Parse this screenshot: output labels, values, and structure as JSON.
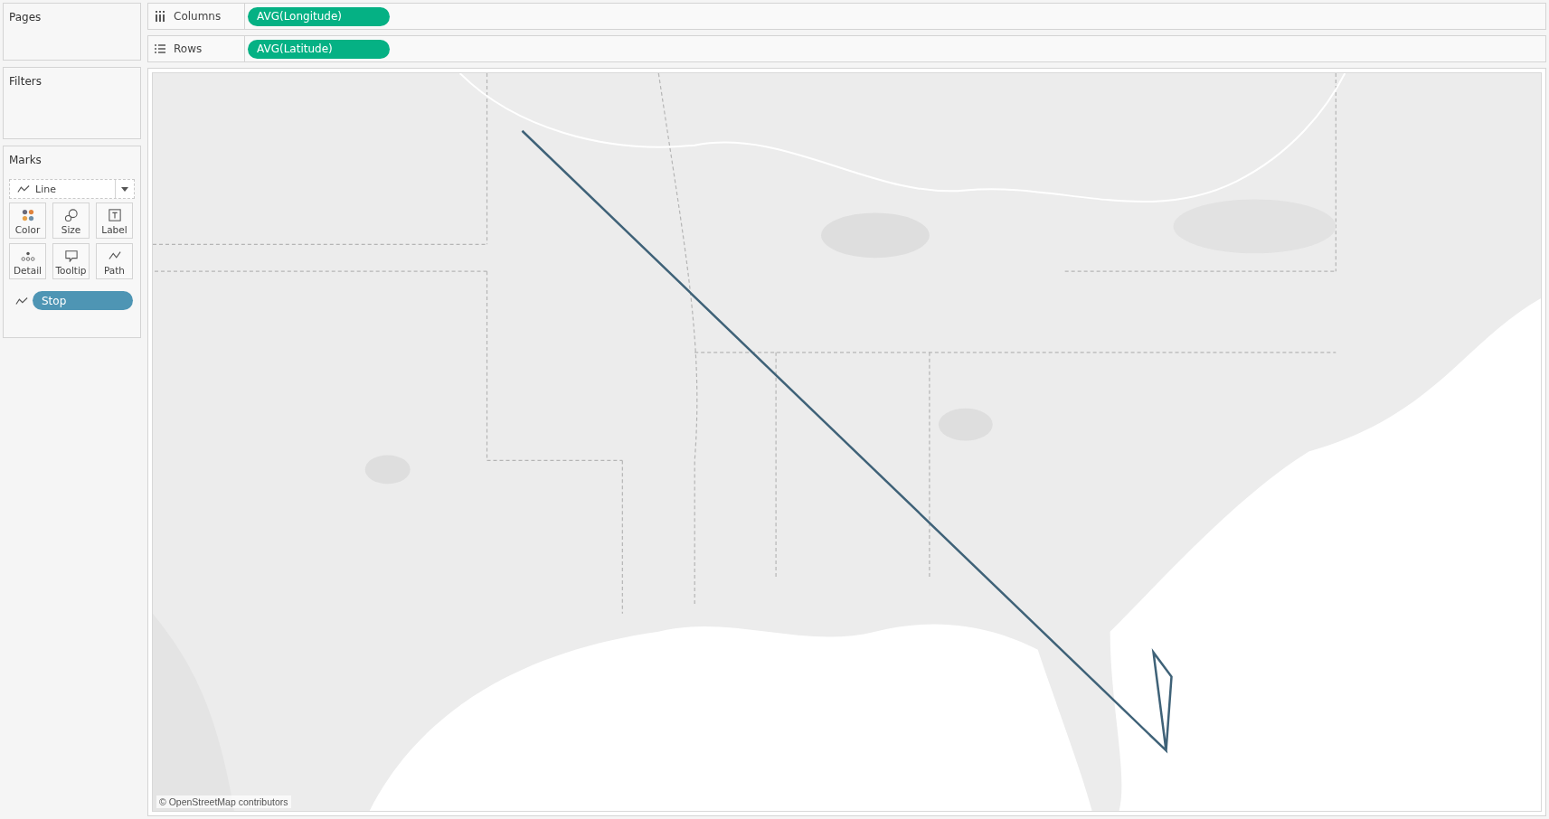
{
  "side_pane": {
    "pages": {
      "title": "Pages"
    },
    "filters": {
      "title": "Filters"
    },
    "marks": {
      "title": "Marks",
      "mark_type": "Line",
      "cards": [
        {
          "label": "Color",
          "kind": "color"
        },
        {
          "label": "Size",
          "kind": "size"
        },
        {
          "label": "Label",
          "kind": "label"
        },
        {
          "label": "Detail",
          "kind": "detail"
        },
        {
          "label": "Tooltip",
          "kind": "tooltip"
        },
        {
          "label": "Path",
          "kind": "path"
        }
      ],
      "fields": [
        {
          "label": "Stop",
          "kind": "path"
        }
      ]
    }
  },
  "shelves": [
    {
      "label": "Columns",
      "kind": "columns",
      "pills": [
        "AVG(Longitude)"
      ]
    },
    {
      "label": "Rows",
      "kind": "rows",
      "pills": [
        "AVG(Latitude)"
      ]
    }
  ],
  "view": {
    "attribution": "© OpenStreetMap contributors"
  }
}
